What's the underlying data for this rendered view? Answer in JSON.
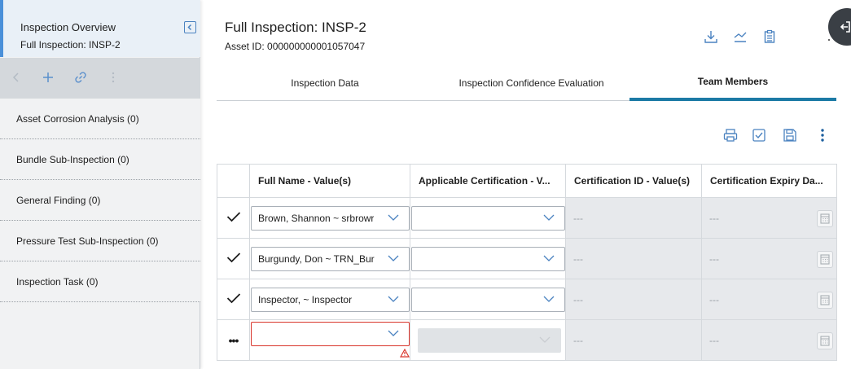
{
  "overview": {
    "title": "Inspection Overview",
    "subtitle": "Full Inspection: INSP-2"
  },
  "left_toolbar": {
    "back_icon": "chevron-left-icon",
    "add_icon": "plus-icon",
    "link_icon": "link-icon",
    "more_icon": "kebab-icon"
  },
  "nav_items": [
    {
      "label": "Asset Corrosion Analysis (0)"
    },
    {
      "label": "Bundle Sub-Inspection (0)"
    },
    {
      "label": "General Finding (0)"
    },
    {
      "label": "Pressure Test Sub-Inspection (0)"
    },
    {
      "label": "Inspection Task (0)"
    }
  ],
  "header": {
    "title": "Full Inspection: INSP-2",
    "asset_id": "Asset ID: 000000000001057047"
  },
  "tabs": [
    {
      "label": "Inspection Data",
      "active": false
    },
    {
      "label": "Inspection Confidence Evaluation",
      "active": false
    },
    {
      "label": "Team Members",
      "active": true
    }
  ],
  "table": {
    "columns": [
      "",
      "Full Name - Value(s)",
      "Applicable Certification - V...",
      "Certification ID - Value(s)",
      "Certification Expiry Da..."
    ],
    "rows": [
      {
        "status": "✓",
        "full_name": "Brown, Shannon ~ srbrowr",
        "certification": "",
        "cert_id": "---",
        "expiry": "---"
      },
      {
        "status": "✓",
        "full_name": "Burgundy, Don ~ TRN_Burg",
        "certification": "",
        "cert_id": "---",
        "expiry": "---"
      },
      {
        "status": "✓",
        "full_name": "Inspector,  ~ Inspector",
        "certification": "",
        "cert_id": "---",
        "expiry": "---"
      },
      {
        "status": "•••",
        "full_name": "",
        "certification": "",
        "cert_id": "---",
        "expiry": "---"
      }
    ]
  },
  "colors": {
    "accent": "#1c7aa5",
    "icon_blue": "#4a82c0",
    "error": "#d9342b"
  }
}
